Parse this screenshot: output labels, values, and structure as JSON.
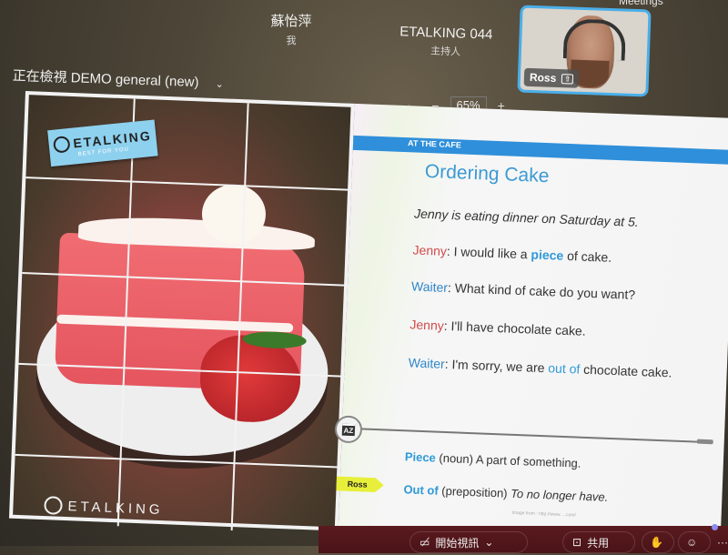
{
  "meeting": {
    "participants": [
      {
        "name": "蘇怡萍",
        "role": "我"
      },
      {
        "name": "ETALKING 044",
        "role": "主持人"
      }
    ],
    "top_right_label": "Meetings",
    "video_tile": {
      "name": "Ross",
      "pin_icon": "⇧"
    },
    "share_title": "正在檢視 DEMO general (new)",
    "share_chevron": "⌄",
    "nav": {
      "prev": "‹",
      "more": "···",
      "next": "›",
      "zoom_out": "−",
      "zoom_level": "65%",
      "zoom_in": "+"
    }
  },
  "slide": {
    "brand": "ETALKING",
    "brand_tagline": "BEST FOR YOU",
    "band_label": "AT THE CAFE",
    "title": "Ordering Cake",
    "intro": "Jenny is eating dinner on Saturday at 5.",
    "dialogue": [
      {
        "speaker": "Jenny",
        "pre": " I would like a ",
        "highlight": "piece",
        "post": " of cake."
      },
      {
        "speaker": "Waiter",
        "pre": " What kind of cake do you want?",
        "highlight": "",
        "post": ""
      },
      {
        "speaker": "Jenny",
        "pre": " I'll have chocolate cake.",
        "highlight": "",
        "post": ""
      },
      {
        "speaker": "Waiter",
        "pre": " I'm sorry, we are ",
        "highlight": "out of",
        "post": " chocolate cake."
      }
    ],
    "vocab": [
      {
        "term": "Piece",
        "pos": " (noun) ",
        "def": "A part of something."
      },
      {
        "term": "Out of",
        "pos": " (preposition) ",
        "def": "To no longer have."
      }
    ],
    "az_icon": "AZ",
    "pointer_label": "Ross",
    "image_credit": "Image from : http://www.....com/"
  },
  "toolbar": {
    "video_label": "開始視訊",
    "video_chevron": "⌄",
    "share_label": "共用",
    "more": "···"
  }
}
